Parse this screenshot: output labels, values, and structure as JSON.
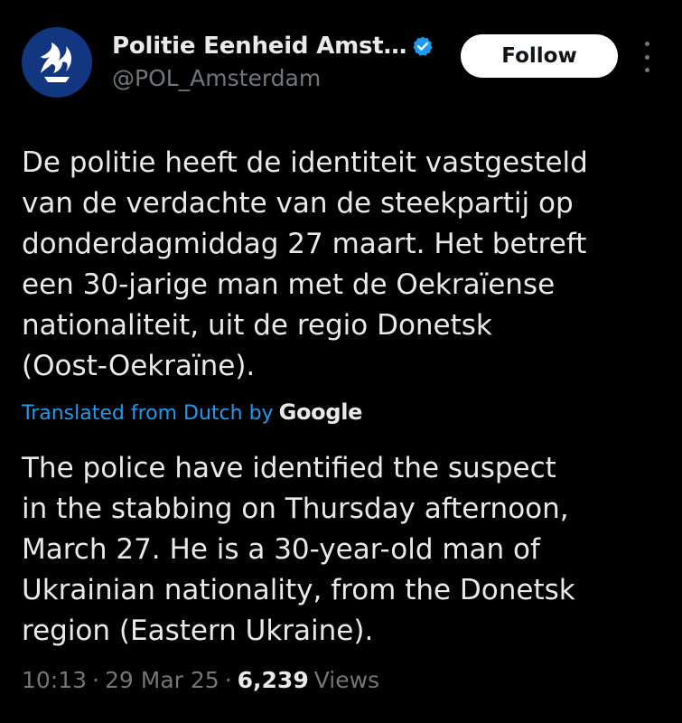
{
  "header": {
    "display_name": "Politie Eenheid Amst…",
    "handle": "@POL_Amsterdam",
    "follow_label": "Follow",
    "avatar_color": "#12367f",
    "verified_color": "#1d9bf0"
  },
  "tweet": {
    "original_text": "De politie heeft de identiteit vastgesteld\nvan de verdachte van de steekpartij op\ndonderdagmiddag 27 maart. Het betreft\neen 30-jarige man met de Oekraïense\nnationaliteit, uit de regio Donetsk\n(Oost-Oekraïne).",
    "translated_from": "Translated from Dutch by",
    "translator": "Google",
    "translated_text": "The police have identified the suspect\nin the stabbing on Thursday afternoon,\nMarch 27. He is a 30-year-old man of\nUkrainian nationality, from the Donetsk\nregion (Eastern Ukraine)."
  },
  "meta": {
    "time": "10:13",
    "separator": "·",
    "date": "29 Mar 25",
    "views_count": "6,239",
    "views_label": "Views"
  },
  "icons": {
    "avatar_logo": "police-flame-logo-icon",
    "verified": "verified-badge-icon",
    "more": "more-options-icon"
  }
}
